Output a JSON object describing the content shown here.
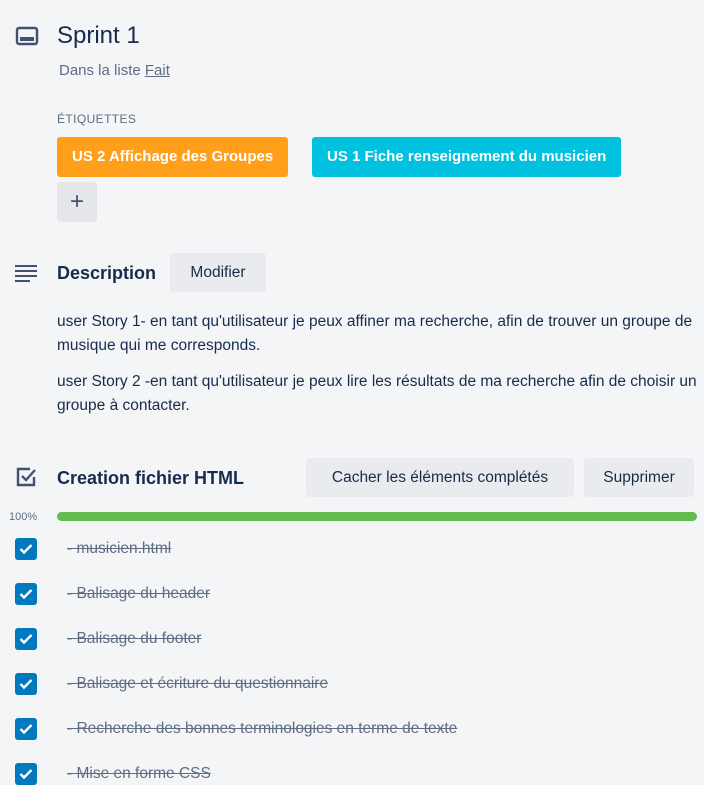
{
  "card": {
    "title": "Sprint 1",
    "list_prefix": "Dans la liste",
    "list_name": "Fait"
  },
  "labels": {
    "heading": "ÉTIQUETTES",
    "items": [
      {
        "text": "US 2 Affichage des Groupes",
        "color": "#ff9f1a"
      },
      {
        "text": "US 1 Fiche renseignement du musicien",
        "color": "#00c2e0"
      }
    ],
    "add_symbol": "+"
  },
  "description": {
    "heading": "Description",
    "edit_label": "Modifier",
    "paragraphs": [
      "user Story 1- en tant qu'utilisateur je peux affiner ma recherche, afin de trouver un groupe de musique qui me corresponds.",
      "user Story 2 -en tant qu'utilisateur je peux lire les résultats de ma recherche afin de choisir un groupe à contacter."
    ]
  },
  "checklist": {
    "title": "Creation fichier HTML",
    "hide_completed_label": "Cacher les éléments complétés",
    "delete_label": "Supprimer",
    "progress_text": "100%",
    "progress": 1.0,
    "progress_color": "#61bd4f",
    "check_color": "#0079bf",
    "items": [
      {
        "text": "- musicien.html",
        "checked": true
      },
      {
        "text": "- Balisage du header",
        "checked": true
      },
      {
        "text": "- Balisage du footer",
        "checked": true
      },
      {
        "text": "- Balisage et écriture du questionnaire",
        "checked": true
      },
      {
        "text": "- Recherche des bonnes terminologies en terme de texte",
        "checked": true
      },
      {
        "text": "- Mise en forme CSS",
        "checked": true
      }
    ]
  }
}
